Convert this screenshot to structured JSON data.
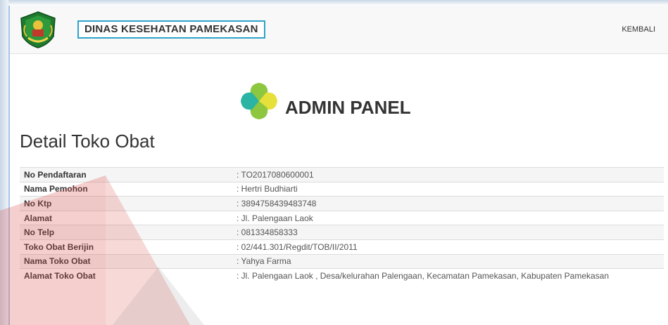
{
  "header": {
    "brand": "DINAS KESEHATAN PAMEKASAN",
    "back_link": "KEMBALI"
  },
  "admin": {
    "title": "ADMIN PANEL"
  },
  "page": {
    "title": "Detail Toko Obat"
  },
  "details": [
    {
      "label": "No Pendaftaran",
      "value": ": TO2017080600001"
    },
    {
      "label": "Nama Pemohon",
      "value": ": Hertri Budhiarti"
    },
    {
      "label": "No Ktp",
      "value": ": 3894758439483748"
    },
    {
      "label": "Alamat",
      "value": ": Jl. Palengaan Laok"
    },
    {
      "label": "No Telp",
      "value": ": 081334858333"
    },
    {
      "label": "Toko Obat Berijin",
      "value": ": 02/441.301/Regdit/TOB/II/2011"
    },
    {
      "label": "Nama Toko Obat",
      "value": ": Yahya Farma"
    },
    {
      "label": "Alamat Toko Obat",
      "value": ": Jl. Palengaan Laok , Desa/kelurahan Palengaan, Kecamatan Pamekasan, Kabupaten Pamekasan"
    }
  ],
  "colors": {
    "accent_border": "#2fa3c9",
    "logo_teal": "#2bb3a3",
    "logo_green": "#8dc63f",
    "logo_yellow": "#e6e03b"
  }
}
